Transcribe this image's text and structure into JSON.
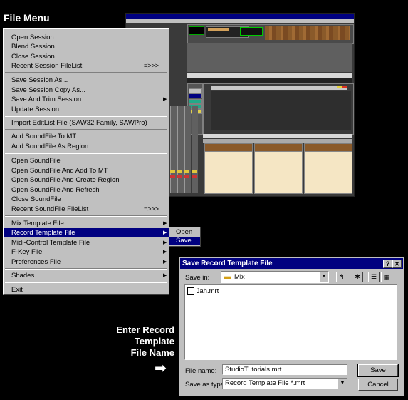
{
  "page_title": "File Menu",
  "menu": {
    "items": [
      {
        "label": "Open Session"
      },
      {
        "label": "Blend Session"
      },
      {
        "label": "Close Session"
      },
      {
        "label": "Recent Session FileList",
        "accel": "=>>>"
      },
      {
        "label": "Save Session As..."
      },
      {
        "label": "Save Session Copy As..."
      },
      {
        "label": "Save And Trim Session",
        "submenu": true
      },
      {
        "label": "Update Session"
      },
      {
        "label": "Import EditList File (SAW32 Family, SAWPro)"
      },
      {
        "label": "Add SoundFile To MT"
      },
      {
        "label": "Add SoundFile As Region"
      },
      {
        "label": "Open SoundFile"
      },
      {
        "label": "Open SoundFile And Add To MT"
      },
      {
        "label": "Open SoundFile And Create Region"
      },
      {
        "label": "Open SoundFile And Refresh"
      },
      {
        "label": "Close SoundFile"
      },
      {
        "label": "Recent SoundFile FileList",
        "accel": "=>>>"
      },
      {
        "label": "Mix Template File",
        "submenu": true
      },
      {
        "label": "Record Template File",
        "submenu": true,
        "selected": true
      },
      {
        "label": "Midi-Control Template File",
        "submenu": true
      },
      {
        "label": "F-Key File",
        "submenu": true
      },
      {
        "label": "Preferences File",
        "submenu": true
      },
      {
        "label": "Shades",
        "submenu": true
      },
      {
        "label": "Exit"
      }
    ],
    "arrow_glyph": "▶"
  },
  "submenu": {
    "items": [
      {
        "label": "Open"
      },
      {
        "label": "Save",
        "selected": true
      }
    ]
  },
  "dialog": {
    "title": "Save Record Template File",
    "help_button": "?",
    "close_button": "✕",
    "save_in_label": "Save in:",
    "save_in_value": "Mix",
    "files": [
      "Jah.mrt"
    ],
    "file_name_label": "File name:",
    "file_name_value": "StudioTutorials.mrt",
    "save_as_type_label": "Save as type:",
    "save_as_type_value": "Record Template File  *.mrt",
    "save_button": "Save",
    "cancel_button": "Cancel"
  },
  "annotation": {
    "line1": "Enter Record",
    "line2": "Template",
    "line3": "File Name"
  },
  "colors": {
    "menu_bg": "#c0c0c0",
    "selection": "#000080",
    "background": "#000000"
  }
}
